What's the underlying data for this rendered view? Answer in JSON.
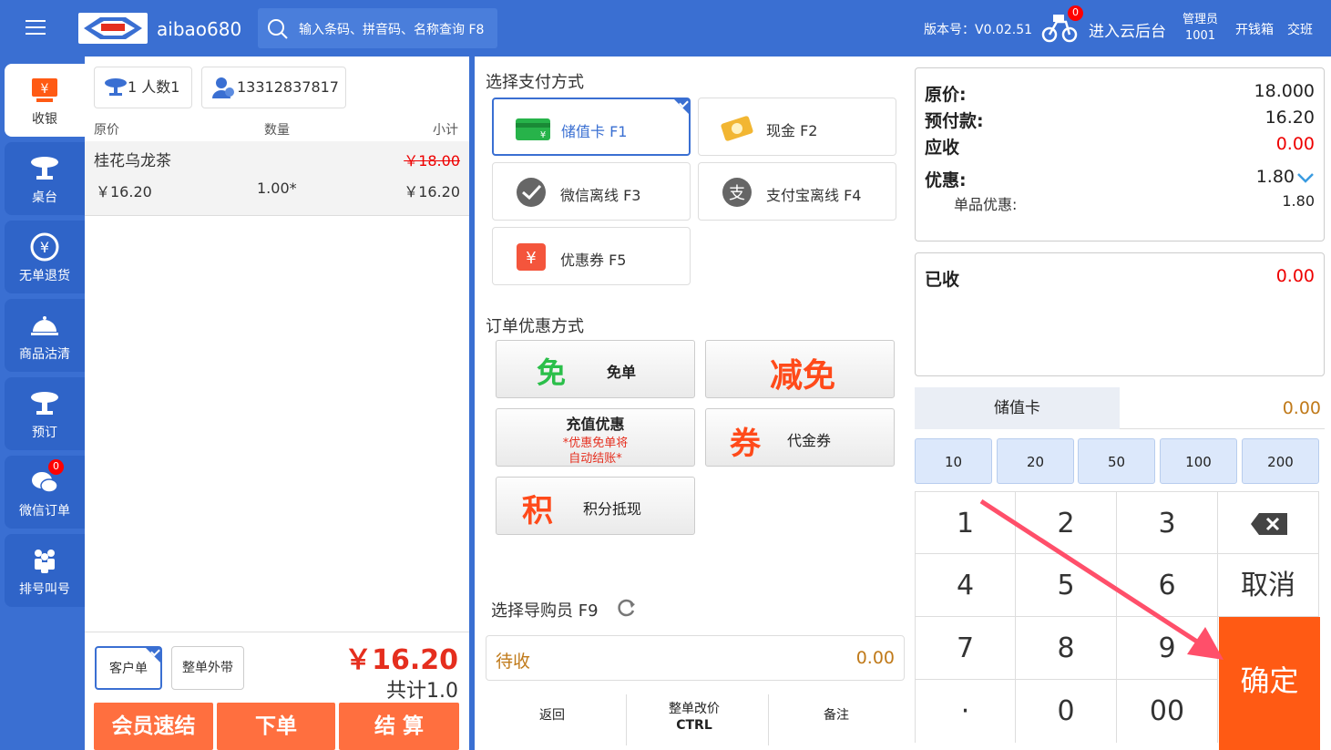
{
  "header": {
    "shop_name": "aibao680",
    "logo_text": "AIBAO",
    "search_placeholder": "输入条码、拼音码、名称查询 F8",
    "version": "版本号：V0.02.51",
    "cloud_badge": "0",
    "cloud_label": "进入云后台",
    "user_role": "管理员",
    "user_id": "1001",
    "cash_drawer": "开钱箱",
    "shift": "交班"
  },
  "sidebar": {
    "items": [
      {
        "label": "收银"
      },
      {
        "label": "桌台"
      },
      {
        "label": "无单退货"
      },
      {
        "label": "商品沽清"
      },
      {
        "label": "预订"
      },
      {
        "label": "微信订单",
        "badge": "0"
      },
      {
        "label": "排号叫号"
      }
    ]
  },
  "order": {
    "people_chip": "1 人数1",
    "member_chip": "13312837817",
    "columns": {
      "price": "原价",
      "qty": "数量",
      "subtotal": "小计"
    },
    "items": [
      {
        "name": "桂花乌龙茶",
        "orig_price": "￥18.00",
        "price": "￥16.20",
        "qty": "1.00*",
        "subtotal": "￥16.20"
      }
    ],
    "type_customer": "客户单",
    "type_takeout": "整单外带",
    "total_amount": "￥16.20",
    "total_qty": "共计1.0",
    "btn_member": "会员速结",
    "btn_order": "下单",
    "btn_checkout": "结 算"
  },
  "payment": {
    "title": "选择支付方式",
    "methods": [
      {
        "label": "储值卡 F1"
      },
      {
        "label": "现金 F2"
      },
      {
        "label": "微信离线 F3"
      },
      {
        "label": "支付宝离线 F4"
      },
      {
        "label": "优惠券 F5"
      }
    ],
    "discount_title": "订单优惠方式",
    "discounts": {
      "free_big": "免",
      "free_label": "免单",
      "reduce_big": "减免",
      "recharge_label": "充值优惠",
      "recharge_note1": "*优惠免单将",
      "recharge_note2": "自动结账*",
      "voucher_big": "券",
      "voucher_label": "代金券",
      "points_big": "积",
      "points_label": "积分抵现"
    },
    "guide_label": "选择导购员 F9",
    "pending_label": "待收",
    "pending_value": "0.00",
    "btn_back": "返回",
    "btn_reprice": "整单改价",
    "btn_reprice_key": "CTRL",
    "btn_note": "备注"
  },
  "summary": {
    "orig_label": "原价:",
    "orig_value": "18.000",
    "prepay_label": "预付款:",
    "prepay_value": "16.20",
    "due_label": "应收",
    "due_value": "0.00",
    "discount_label": "优惠:",
    "discount_value": "1.80",
    "item_discount_label": "单品优惠:",
    "item_discount_value": "1.80",
    "received_label": "已收",
    "received_value": "0.00",
    "card_label": "储值卡",
    "card_value": "0.00",
    "quick_amounts": [
      "10",
      "20",
      "50",
      "100",
      "200"
    ]
  },
  "keypad": {
    "keys": [
      "1",
      "2",
      "3",
      "4",
      "5",
      "6",
      "7",
      "8",
      "9",
      "·",
      "0",
      "00"
    ],
    "cancel": "取消",
    "confirm": "确定"
  },
  "colors": {
    "brand_blue": "#3a6fd2",
    "accent_orange": "#ff6f3f",
    "confirm_orange": "#ff5a14",
    "price_red": "#e52e1e"
  }
}
